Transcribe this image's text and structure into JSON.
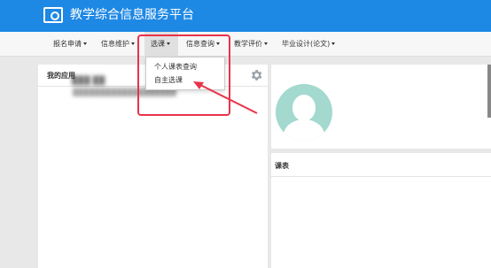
{
  "header": {
    "app_title": "教学综合信息服务平台"
  },
  "navbar": {
    "items": [
      {
        "label": "报名申请",
        "name": "nav-registration"
      },
      {
        "label": "信息维护",
        "name": "nav-info-maintenance"
      },
      {
        "label": "选课",
        "name": "nav-course-selection"
      },
      {
        "label": "信息查询",
        "name": "nav-info-query"
      },
      {
        "label": "教学评价",
        "name": "nav-teaching-evaluation"
      },
      {
        "label": "毕业设计(论文)",
        "name": "nav-graduation-project"
      }
    ]
  },
  "dropdown": {
    "items": [
      {
        "label": "个人课表查询"
      },
      {
        "label": "自主选课"
      }
    ]
  },
  "left_panel": {
    "title": "我的应用"
  },
  "profile": {
    "name_blurred": "███ ██",
    "info_blurred": "███████████████████"
  },
  "schedule_panel": {
    "title": "课表"
  },
  "colors": {
    "header_bg": "#1e88e5",
    "highlight": "#e8334a",
    "avatar": "#a3d9cf"
  }
}
